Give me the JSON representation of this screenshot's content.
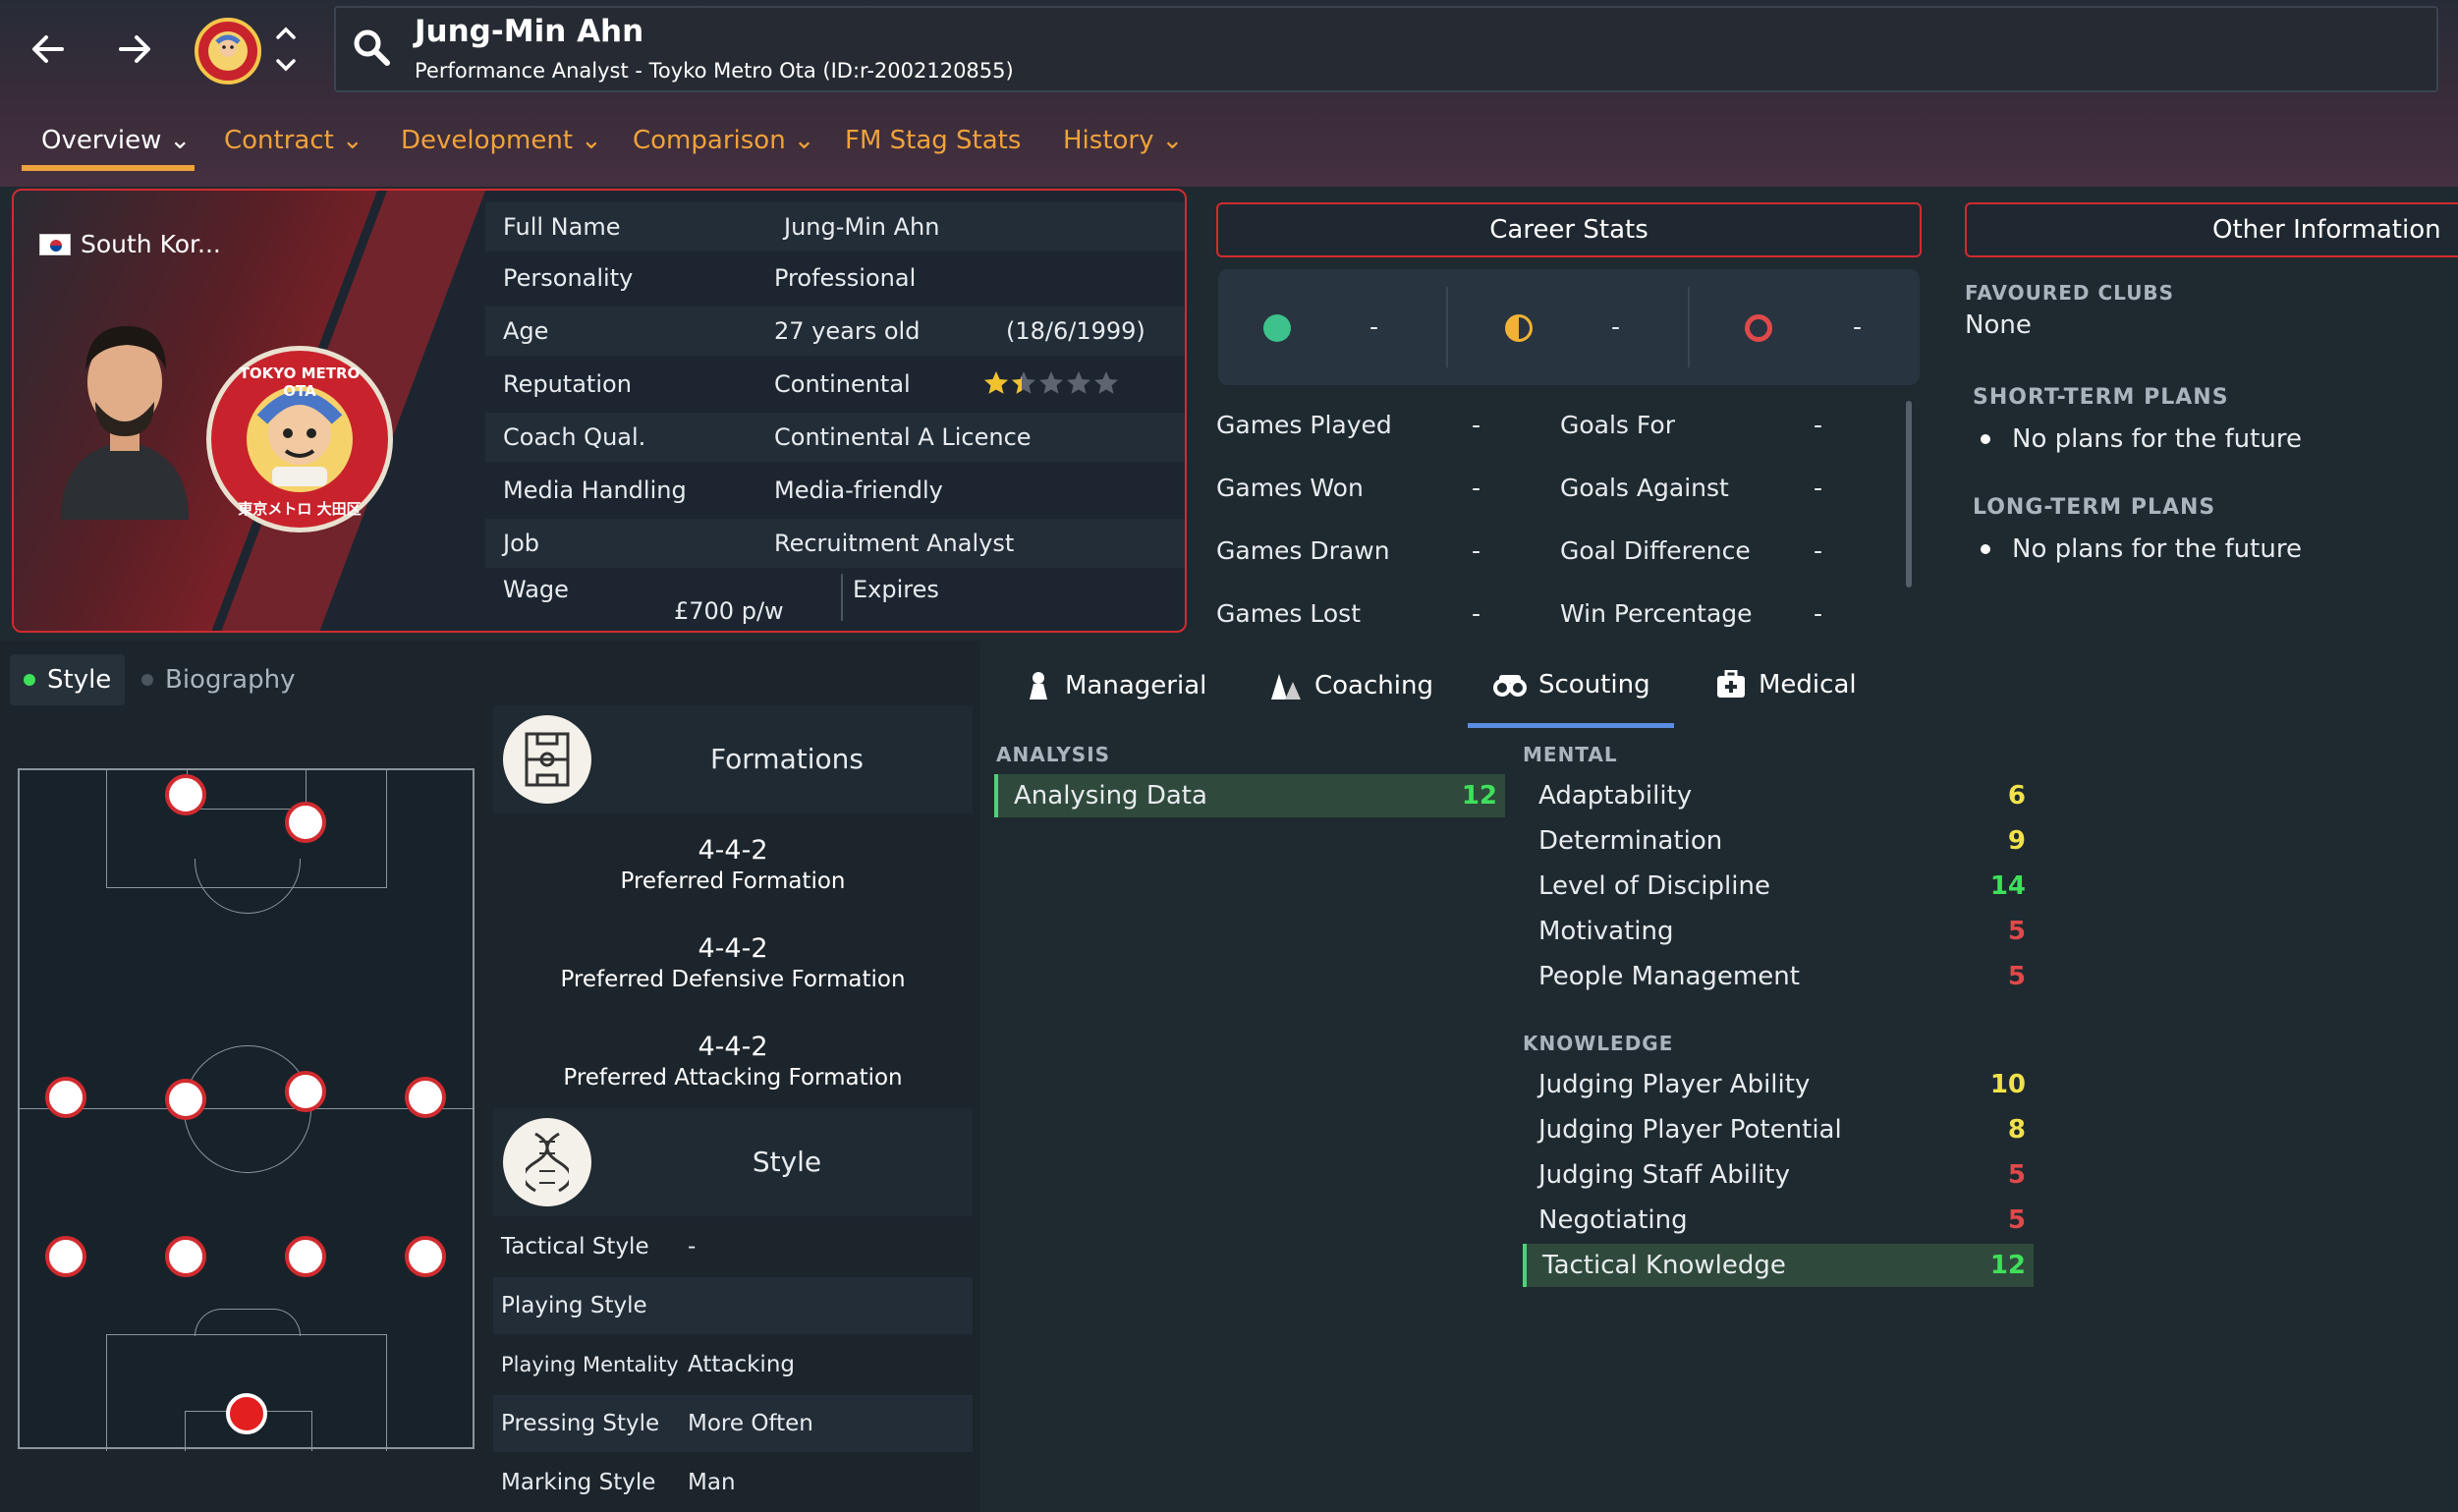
{
  "header": {
    "name": "Jung-Min Ahn",
    "subtitle": "Performance Analyst - Toyko Metro Ota (ID:r-2002120855)"
  },
  "tabs": [
    {
      "label": "Overview"
    },
    {
      "label": "Contract"
    },
    {
      "label": "Development"
    },
    {
      "label": "Comparison"
    },
    {
      "label": "FM Stag Stats"
    },
    {
      "label": "History"
    }
  ],
  "profile": {
    "nation": "South Kor...",
    "full_name_label": "Full Name",
    "full_name": "Jung-Min Ahn",
    "personality_label": "Personality",
    "personality": "Professional",
    "age_label": "Age",
    "age": "27 years old",
    "dob": "(18/6/1999)",
    "reputation_label": "Reputation",
    "reputation": "Continental",
    "reputation_stars": 1.5,
    "coach_label": "Coach Qual.",
    "coach": "Continental A Licence",
    "media_label": "Media Handling",
    "media": "Media-friendly",
    "job_label": "Job",
    "job": "Recruitment Analyst",
    "wage_label": "Wage",
    "wage": "£700 p/w",
    "expires_label": "Expires",
    "badge_top": "TOKYO METRO OTA",
    "badge_bottom": "東京メトロ 大田区"
  },
  "career": {
    "title": "Career Stats",
    "won": "-",
    "drawn": "-",
    "lost": "-",
    "rows": [
      {
        "l1": "Games Played",
        "v1": "-",
        "l2": "Goals For",
        "v2": "-"
      },
      {
        "l1": "Games Won",
        "v1": "-",
        "l2": "Goals Against",
        "v2": "-"
      },
      {
        "l1": "Games Drawn",
        "v1": "-",
        "l2": "Goal Difference",
        "v2": "-"
      },
      {
        "l1": "Games Lost",
        "v1": "-",
        "l2": "Win Percentage",
        "v2": "-"
      }
    ]
  },
  "other": {
    "title": "Other Information",
    "fav_label": "FAVOURED CLUBS",
    "fav": "None",
    "short_label": "SHORT-TERM PLANS",
    "short": "No plans for the future",
    "long_label": "LONG-TERM PLANS",
    "long": "No plans for the future"
  },
  "left_tabs": {
    "style": "Style",
    "bio": "Biography"
  },
  "formations": {
    "title": "Formations",
    "f1": "4-4-2",
    "f1_label": "Preferred Formation",
    "f2": "4-4-2",
    "f2_label": "Preferred Defensive Formation",
    "f3": "4-4-2",
    "f3_label": "Preferred Attacking Formation"
  },
  "style": {
    "title": "Style",
    "rows": [
      {
        "label": "Tactical Style",
        "value": "-"
      },
      {
        "label": "Playing Style",
        "value": ""
      },
      {
        "label": "Playing Mentality",
        "value": "Attacking"
      },
      {
        "label": "Pressing Style",
        "value": "More Often"
      },
      {
        "label": "Marking Style",
        "value": "Man"
      }
    ]
  },
  "attr_tabs": [
    {
      "label": "Managerial",
      "icon": "person-icon"
    },
    {
      "label": "Coaching",
      "icon": "cones-icon"
    },
    {
      "label": "Scouting",
      "icon": "binoculars-icon"
    },
    {
      "label": "Medical",
      "icon": "medical-kit-icon"
    }
  ],
  "analysis": {
    "head": "ANALYSIS",
    "items": [
      {
        "name": "Analysing Data",
        "value": "12"
      }
    ]
  },
  "mental": {
    "head": "MENTAL",
    "items": [
      {
        "name": "Adaptability",
        "value": "6"
      },
      {
        "name": "Determination",
        "value": "9"
      },
      {
        "name": "Level of Discipline",
        "value": "14"
      },
      {
        "name": "Motivating",
        "value": "5"
      },
      {
        "name": "People Management",
        "value": "5"
      }
    ]
  },
  "knowledge": {
    "head": "KNOWLEDGE",
    "items": [
      {
        "name": "Judging Player Ability",
        "value": "10"
      },
      {
        "name": "Judging Player Potential",
        "value": "8"
      },
      {
        "name": "Judging Staff Ability",
        "value": "5"
      },
      {
        "name": "Negotiating",
        "value": "5"
      },
      {
        "name": "Tactical Knowledge",
        "value": "12"
      }
    ]
  },
  "colors": {
    "accent": "#f0a23a",
    "red": "#d12b2f",
    "green": "#3fe05a",
    "yellow": "#f2e24a",
    "low": "#e0494a"
  }
}
